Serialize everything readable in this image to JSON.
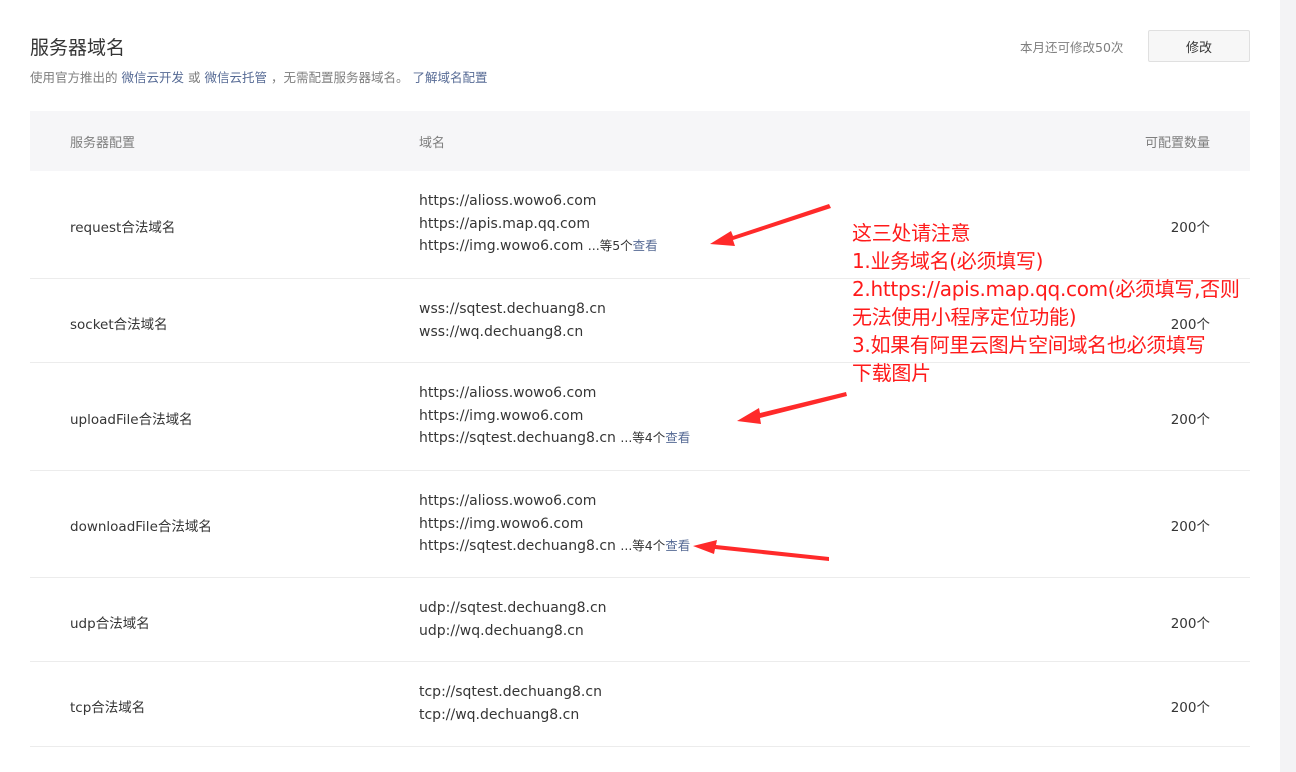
{
  "header": {
    "title": "服务器域名",
    "desc_prefix": "使用官方推出的",
    "link_cloud_dev": "微信云开发",
    "desc_or": "或",
    "link_cloud_host": "微信云托管",
    "desc_suffix": "，无需配置服务器域名。",
    "link_learn": "了解域名配置",
    "quota": "本月还可修改50次",
    "modify_label": "修改"
  },
  "table": {
    "headers": {
      "config": "服务器配置",
      "domain": "域名",
      "count": "可配置数量"
    },
    "rows": [
      {
        "name": "request合法域名",
        "domains": [
          "https://alioss.wowo6.com",
          "https://apis.map.qq.com",
          "https://img.wowo6.com"
        ],
        "more_text": "...等5个",
        "more_link": "查看",
        "count": "200个"
      },
      {
        "name": "socket合法域名",
        "domains": [
          "wss://sqtest.dechuang8.cn",
          "wss://wq.dechuang8.cn"
        ],
        "count": "200个"
      },
      {
        "name": "uploadFile合法域名",
        "domains": [
          "https://alioss.wowo6.com",
          "https://img.wowo6.com",
          "https://sqtest.dechuang8.cn"
        ],
        "more_text": "...等4个",
        "more_link": "查看",
        "count": "200个"
      },
      {
        "name": "downloadFile合法域名",
        "domains": [
          "https://alioss.wowo6.com",
          "https://img.wowo6.com",
          "https://sqtest.dechuang8.cn"
        ],
        "more_text": "...等4个",
        "more_link": "查看",
        "count": "200个"
      },
      {
        "name": "udp合法域名",
        "domains": [
          "udp://sqtest.dechuang8.cn",
          "udp://wq.dechuang8.cn"
        ],
        "count": "200个"
      },
      {
        "name": "tcp合法域名",
        "domains": [
          "tcp://sqtest.dechuang8.cn",
          "tcp://wq.dechuang8.cn"
        ],
        "count": "200个"
      }
    ]
  },
  "annotation": {
    "lines": [
      "这三处请注意",
      "1.业务域名(必须填写)",
      "2.https://apis.map.qq.com(必须填写,否则",
      "无法使用小程序定位功能)",
      "3.如果有阿里云图片空间域名也必须填写",
      "下载图片"
    ],
    "color": "#ff1a1a"
  }
}
